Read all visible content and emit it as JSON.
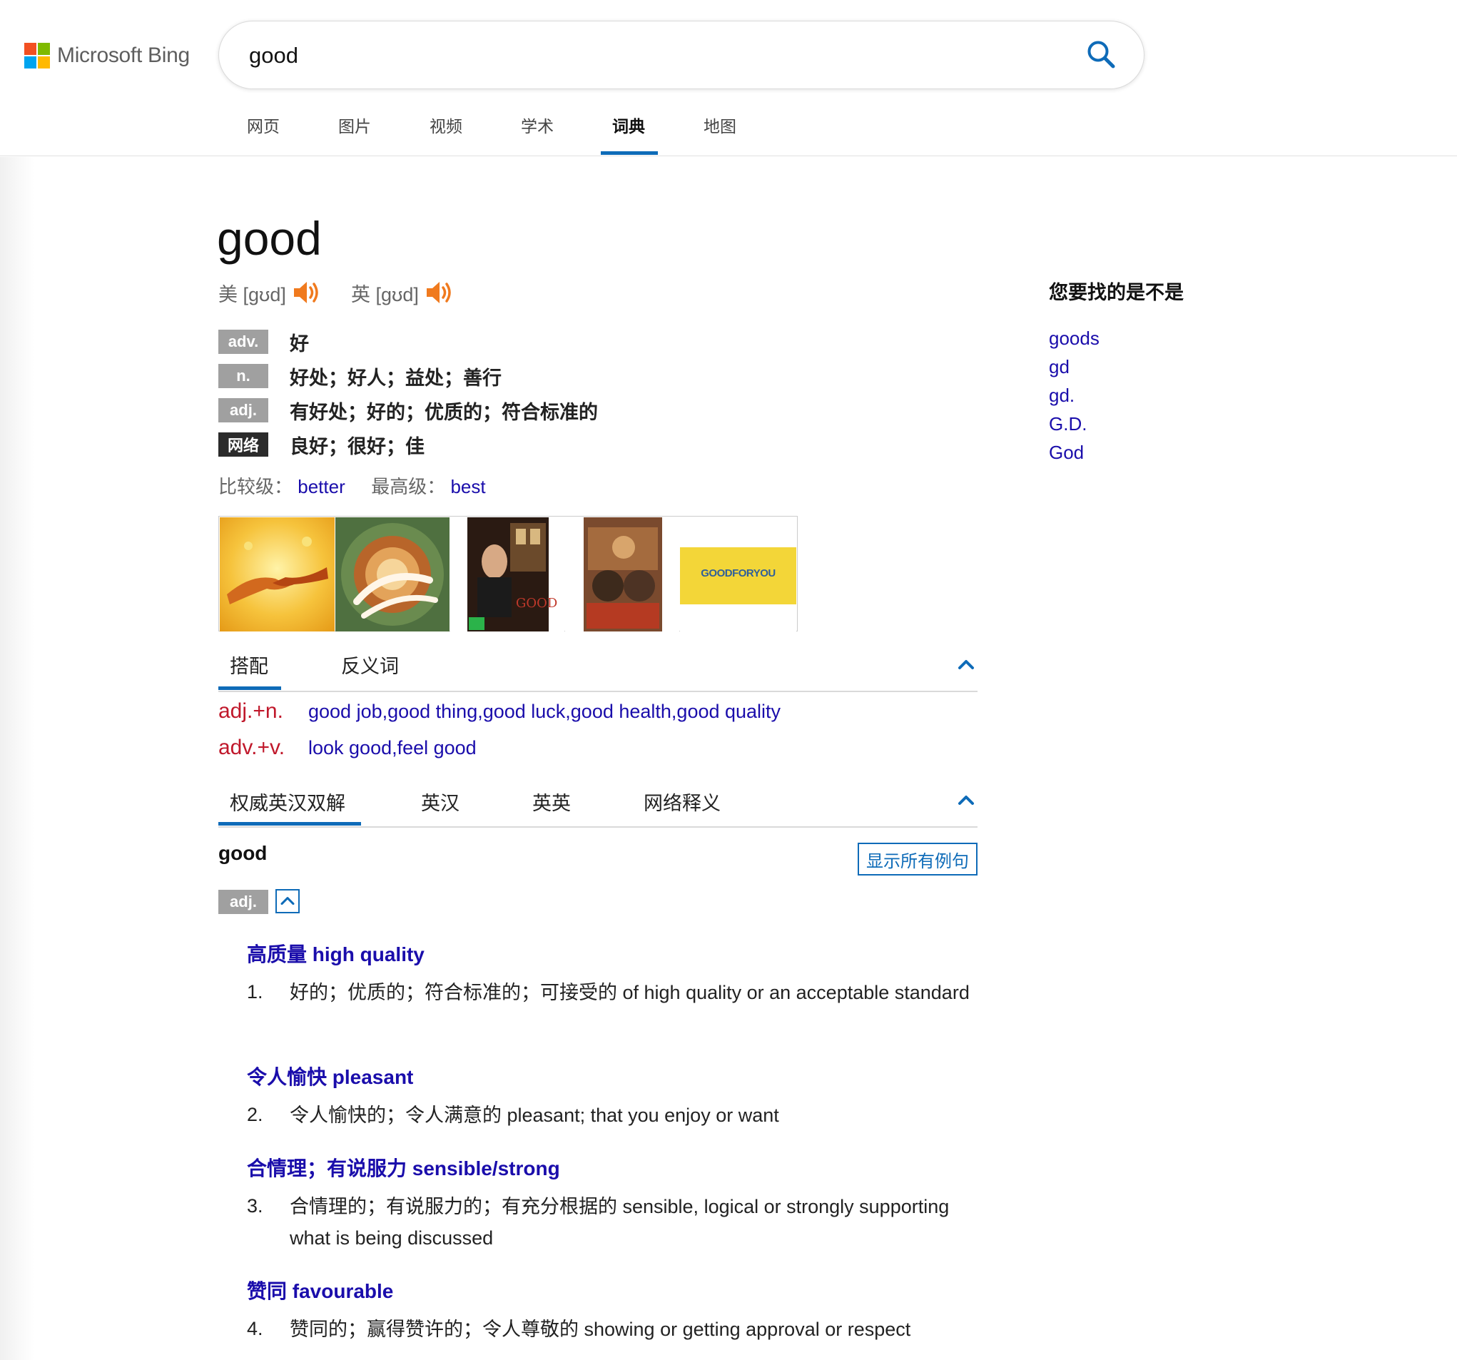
{
  "brand": {
    "name": "Microsoft Bing",
    "colors": [
      "#f25022",
      "#7fba00",
      "#00a4ef",
      "#ffb900"
    ]
  },
  "search": {
    "query": "good",
    "icon": "search-icon"
  },
  "nav": {
    "items": [
      {
        "label": "网页"
      },
      {
        "label": "图片"
      },
      {
        "label": "视频"
      },
      {
        "label": "学术"
      },
      {
        "label": "词典",
        "active": true
      },
      {
        "label": "地图"
      }
    ]
  },
  "word": {
    "headword": "good",
    "pron_us": "美 [ɡʊd]",
    "pron_uk": "英 [ɡʊd]",
    "definitions": [
      {
        "pos": "adv.",
        "text": "好"
      },
      {
        "pos": "n.",
        "text": "好处；好人；益处；善行"
      },
      {
        "pos": "adj.",
        "text": "有好处；好的；优质的；符合标准的"
      },
      {
        "pos": "网络",
        "text": "良好；很好；佳"
      }
    ],
    "comparative_label": "比较级：",
    "comparative": "better",
    "superlative_label": "最高级：",
    "superlative": "best"
  },
  "images": [
    {
      "name": "handshake-image"
    },
    {
      "name": "good-vibes-image"
    },
    {
      "name": "good-movie-poster"
    },
    {
      "name": "good-omens-poster"
    },
    {
      "name": "goodforyou-image",
      "text": "GOODFORYOU"
    }
  ],
  "collocation_tabs": {
    "tabs": [
      {
        "label": "搭配",
        "active": true
      },
      {
        "label": "反义词"
      }
    ],
    "rows": [
      {
        "pos": "adj.+n.",
        "links": "good job,good thing,good luck,good health,good quality"
      },
      {
        "pos": "adv.+v.",
        "links": "look good,feel good"
      }
    ]
  },
  "dict_tabs": {
    "tabs": [
      {
        "label": "权威英汉双解",
        "active": true
      },
      {
        "label": "英汉"
      },
      {
        "label": "英英"
      },
      {
        "label": "网络释义"
      }
    ]
  },
  "entry": {
    "word": "good",
    "show_all_label": "显示所有例句",
    "pos": "adj.",
    "senses": [
      {
        "head": "高质量 high quality",
        "num": "1.",
        "text": "好的；优质的；符合标准的；可接受的 of high quality or an acceptable standard"
      },
      {
        "head": "令人愉快 pleasant",
        "num": "2.",
        "text": "令人愉快的；令人满意的 pleasant; that you enjoy or want"
      },
      {
        "head": "合情理；有说服力 sensible/strong",
        "num": "3.",
        "text": "合情理的；有说服力的；有充分根据的 sensible, logical or strongly supporting what is being discussed"
      },
      {
        "head": "赞同 favourable",
        "num": "4.",
        "text": "赞同的；赢得赞许的；令人尊敬的 showing or getting approval or respect"
      }
    ]
  },
  "sidebar": {
    "title": "您要找的是不是",
    "suggestions": [
      "goods",
      "gd",
      "gd.",
      "G.D.",
      "God"
    ]
  },
  "colors": {
    "accent": "#0e6bb8",
    "link": "#1a0dab",
    "collocation_pos": "#c0182b",
    "speaker": "#f07a1e",
    "pos_tag": "#a0a0a0",
    "net_tag": "#2b2b2b"
  }
}
